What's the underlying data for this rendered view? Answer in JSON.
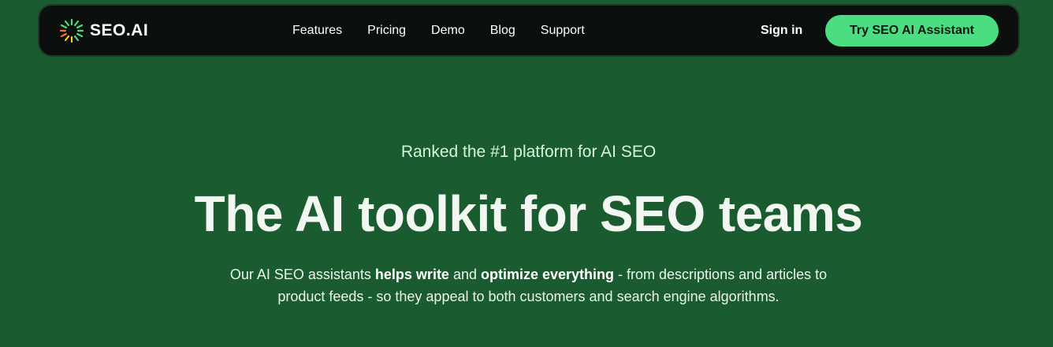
{
  "brand": {
    "logo_text": "SEO.AI",
    "accent_color": "#4ade80",
    "background_color": "#1a5c30"
  },
  "nav": {
    "links": [
      "Features",
      "Pricing",
      "Demo",
      "Blog",
      "Support"
    ],
    "signin_label": "Sign in",
    "cta_label": "Try SEO AI Assistant"
  },
  "hero": {
    "eyebrow": "Ranked the #1 platform for AI SEO",
    "headline": "The AI toolkit for SEO teams",
    "sub_part1": "Our AI SEO assistants ",
    "sub_bold1": "helps write",
    "sub_part2": " and ",
    "sub_bold2": "optimize everything",
    "sub_part3": " - from descriptions and articles to",
    "sub_line2": "product feeds - so they appeal to both customers and search engine algorithms."
  }
}
